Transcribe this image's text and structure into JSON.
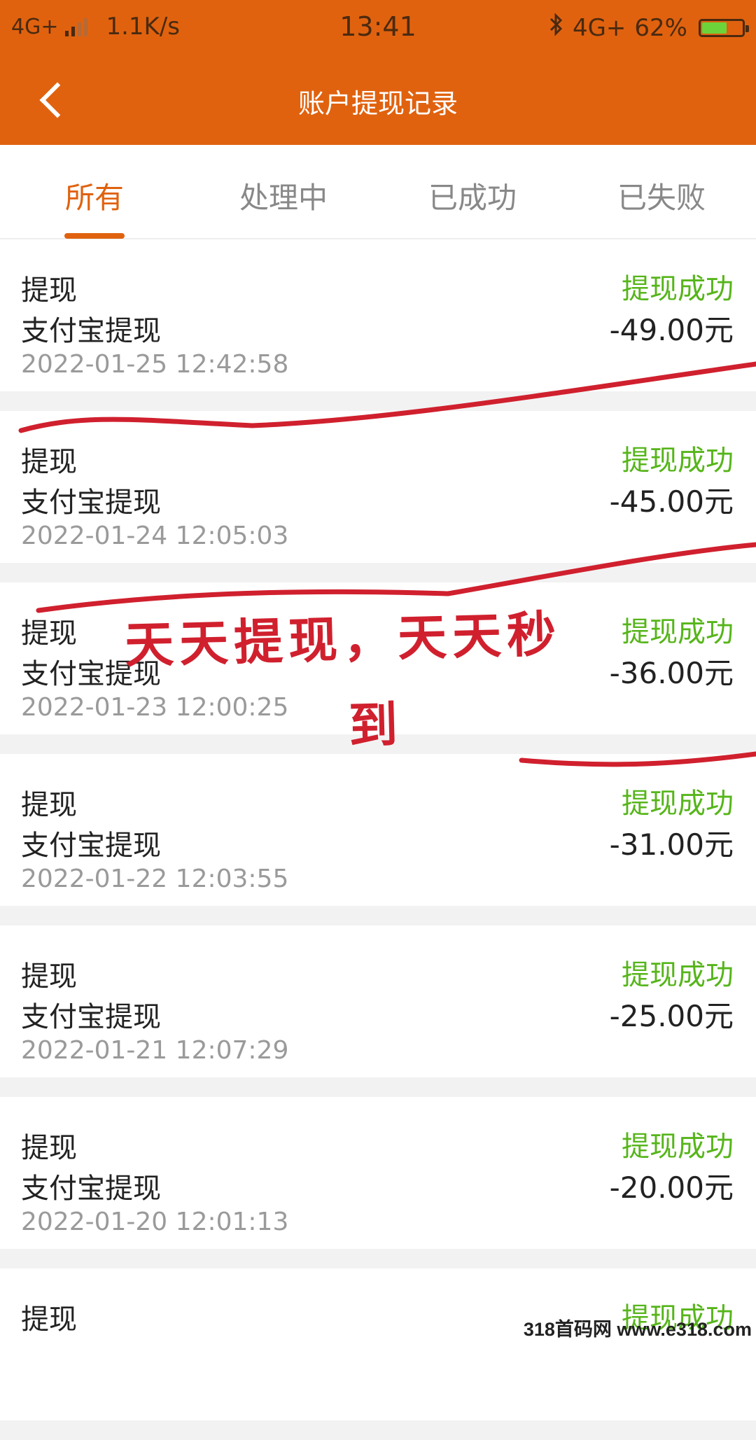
{
  "status_bar": {
    "network": "4G+",
    "speed": "1.1K/s",
    "time": "13:41",
    "bluetooth_icon": "bluetooth-icon",
    "network_right": "4G+",
    "battery": "62%",
    "battery_level": 0.62
  },
  "nav": {
    "title": "账户提现记录",
    "back_icon": "chevron-left-icon"
  },
  "tabs": [
    {
      "label": "所有"
    },
    {
      "label": "处理中"
    },
    {
      "label": "已成功"
    },
    {
      "label": "已失败"
    }
  ],
  "records": [
    {
      "type": "提现",
      "channel": "支付宝提现",
      "time": "2022-01-25 12:42:58",
      "status": "提现成功",
      "amount": "-49.00元"
    },
    {
      "type": "提现",
      "channel": "支付宝提现",
      "time": "2022-01-24 12:05:03",
      "status": "提现成功",
      "amount": "-45.00元"
    },
    {
      "type": "提现",
      "channel": "支付宝提现",
      "time": "2022-01-23 12:00:25",
      "status": "提现成功",
      "amount": "-36.00元"
    },
    {
      "type": "提现",
      "channel": "支付宝提现",
      "time": "2022-01-22 12:03:55",
      "status": "提现成功",
      "amount": "-31.00元"
    },
    {
      "type": "提现",
      "channel": "支付宝提现",
      "time": "2022-01-21 12:07:29",
      "status": "提现成功",
      "amount": "-25.00元"
    },
    {
      "type": "提现",
      "channel": "支付宝提现",
      "time": "2022-01-20 12:01:13",
      "status": "提现成功",
      "amount": "-20.00元"
    },
    {
      "type": "提现",
      "channel": "",
      "time": "",
      "status": "提现成功",
      "amount": ""
    }
  ],
  "annotation": {
    "line1": "天天提现，天天秒",
    "line2": "到"
  },
  "watermark": "318首码网 www.e318.com",
  "colors": {
    "brand": "#e0620f",
    "success": "#56b51a",
    "annotation": "#d0202e"
  }
}
